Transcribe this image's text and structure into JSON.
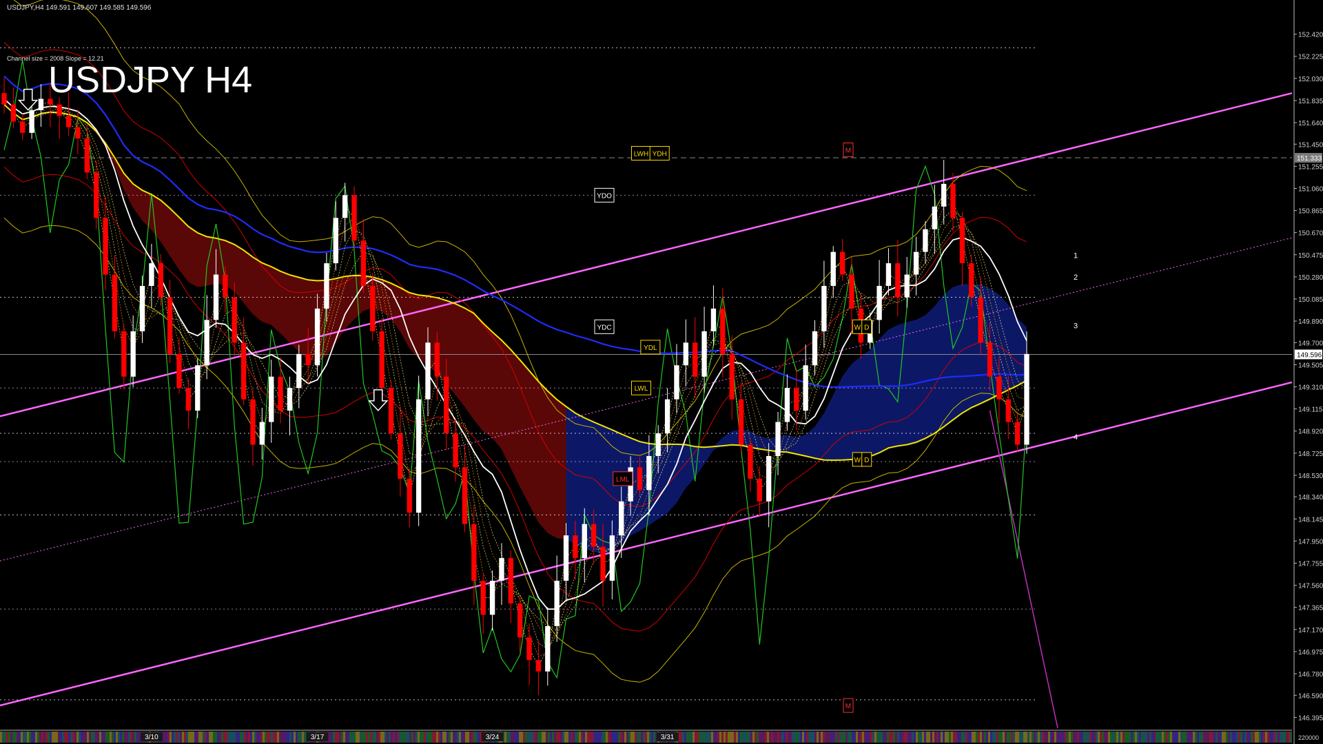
{
  "header": {
    "info_line": "USDJPY,H4  149.591 149.607 149.585 149.596",
    "channel_info": "Channel size = 2008 Slope = 12.21",
    "title": "USDJPY H4"
  },
  "chart_data": {
    "type": "candlestick",
    "symbol": "USDJPY",
    "timeframe": "H4",
    "ylim": [
      146.3,
      152.6
    ],
    "grid": false,
    "y_ticks": [
      152.42,
      152.225,
      152.03,
      151.835,
      151.64,
      151.45,
      151.255,
      151.06,
      150.865,
      150.67,
      150.475,
      150.28,
      150.085,
      149.89,
      149.7,
      149.505,
      149.31,
      149.115,
      148.92,
      148.725,
      148.53,
      148.34,
      148.145,
      147.95,
      147.755,
      147.56,
      147.365,
      147.17,
      146.975,
      146.78,
      146.59,
      146.395
    ],
    "y_tick_labels": [
      "152.420",
      "152.225",
      "152.030",
      "151.835",
      "151.640",
      "151.450",
      "151.255",
      "151.060",
      "150.865",
      "150.670",
      "150.475",
      "150.280",
      "150.085",
      "149.890",
      "149.700",
      "149.505",
      "149.310",
      "149.115",
      "148.920",
      "148.725",
      "148.530",
      "148.340",
      "148.145",
      "147.950",
      "147.755",
      "147.560",
      "147.365",
      "147.170",
      "146.975",
      "146.780",
      "146.590",
      "146.395"
    ],
    "x_labels": [
      {
        "label": "3/10",
        "index": 16
      },
      {
        "label": "3/17",
        "index": 34
      },
      {
        "label": "3/24",
        "index": 53
      },
      {
        "label": "3/31",
        "index": 72
      }
    ],
    "volume_label": "220000",
    "current_price": 149.596,
    "current_price_label": "149.596",
    "marker_price": 151.33,
    "marker_price_label": "151.333",
    "closes": [
      151.8,
      151.65,
      151.55,
      151.75,
      151.85,
      151.8,
      151.7,
      151.6,
      151.5,
      151.2,
      150.8,
      150.3,
      149.8,
      149.4,
      149.8,
      150.2,
      150.4,
      150.1,
      149.6,
      149.3,
      149.1,
      149.5,
      149.9,
      150.3,
      150.1,
      149.7,
      149.2,
      148.8,
      149.0,
      149.4,
      149.1,
      149.3,
      149.6,
      149.5,
      150.0,
      150.4,
      150.8,
      151.0,
      150.6,
      150.2,
      149.8,
      149.3,
      148.9,
      148.5,
      148.2,
      149.2,
      149.7,
      149.4,
      148.9,
      148.6,
      148.1,
      147.6,
      147.3,
      147.6,
      147.8,
      147.4,
      147.1,
      146.9,
      146.8,
      147.2,
      147.6,
      148.0,
      147.8,
      148.1,
      147.9,
      147.6,
      148.0,
      148.3,
      148.6,
      148.4,
      148.7,
      148.9,
      149.2,
      149.5,
      149.7,
      149.4,
      149.8,
      150.0,
      149.6,
      149.2,
      148.8,
      148.5,
      148.3,
      148.7,
      149.0,
      149.3,
      149.1,
      149.5,
      149.8,
      150.2,
      150.5,
      150.3,
      150.0,
      149.7,
      149.9,
      150.2,
      150.4,
      150.1,
      150.3,
      150.5,
      150.7,
      150.9,
      151.1,
      150.8,
      150.4,
      150.1,
      149.7,
      149.4,
      149.2,
      149.0,
      148.8,
      149.6
    ],
    "series_labels": [
      "1",
      "2",
      "3",
      "4"
    ],
    "ma_white_label": "",
    "tags": [
      {
        "text": "YDO",
        "price": 151.0,
        "index": 65
      },
      {
        "text": "YDC",
        "price": 149.84,
        "index": 65
      },
      {
        "text": "YDL",
        "price": 149.66,
        "index": 70
      },
      {
        "text": "LWH",
        "price": 151.37,
        "index": 69
      },
      {
        "text": "YDH",
        "price": 151.37,
        "index": 71
      },
      {
        "text": "LWL",
        "price": 149.3,
        "index": 69
      },
      {
        "text": "LML",
        "price": 148.5,
        "index": 67
      },
      {
        "text": "M",
        "price": 151.4,
        "index": 92
      },
      {
        "text": "M",
        "price": 146.5,
        "index": 92
      },
      {
        "text": "W",
        "price": 149.84,
        "index": 93
      },
      {
        "text": "D",
        "price": 149.84,
        "index": 94
      },
      {
        "text": "W",
        "price": 148.67,
        "index": 93
      },
      {
        "text": "D",
        "price": 148.67,
        "index": 94
      }
    ]
  },
  "colors": {
    "bull": "#ffffff",
    "bear": "#ff0000",
    "ma_blue": "#1f2cff",
    "ma_yellow": "#f2e600",
    "ma_white": "#ffffff",
    "channel": "#ff66ff",
    "green_line": "#22c722",
    "bands_red": "#d40000",
    "bands_yellow": "#c8b400",
    "kumo_red": "#c81010",
    "kumo_blue": "#1f3cff",
    "tag_box": "#ffd700",
    "axis_text": "#d0d0d0"
  }
}
